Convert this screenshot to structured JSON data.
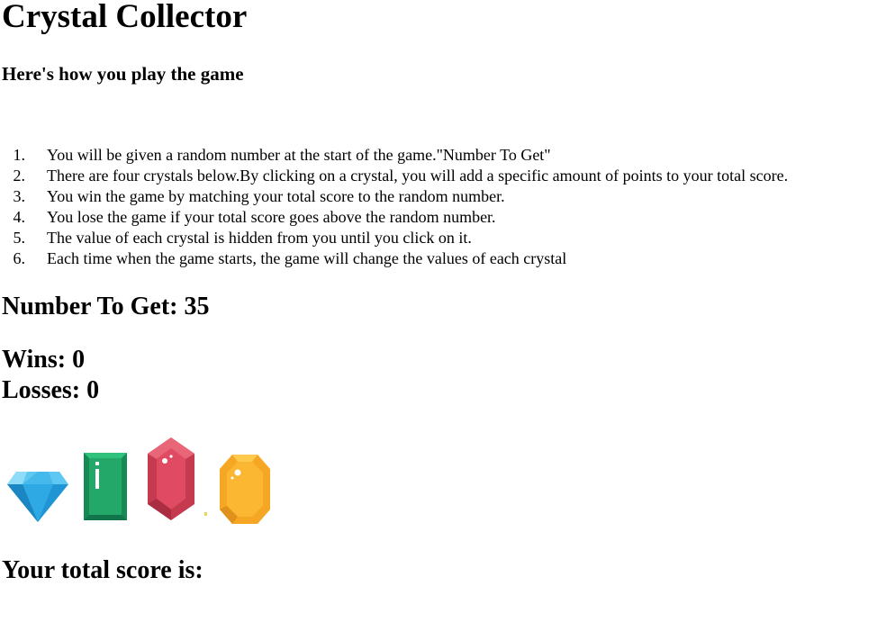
{
  "header": {
    "title": "Crystal Collector",
    "subtitle": "Here's how you play the game"
  },
  "rules": [
    {
      "num": "1.",
      "text": "You will be given a random number at the start of the game.\"Number To Get\""
    },
    {
      "num": "2.",
      "text": "There are four crystals below.By clicking on a crystal, you will add a specific amount of points to your total score."
    },
    {
      "num": "3.",
      "text": "You win the game by matching your total score to the random number."
    },
    {
      "num": "4.",
      "text": "You lose the game if your total score goes above the random number."
    },
    {
      "num": "5.",
      "text": "The value of each crystal is hidden from you until you click on it."
    },
    {
      "num": "6.",
      "text": "Each time when the game starts, the game will change the values of each crystal"
    }
  ],
  "status": {
    "target_label": "Number To Get: ",
    "target_value": "35",
    "wins_label": "Wins: ",
    "wins_value": "0",
    "losses_label": "Losses: ",
    "losses_value": "0",
    "score_label": "Your total score is:",
    "score_value": ""
  },
  "crystals": [
    {
      "icon": "blue-diamond-icon",
      "color": "#29a6e0"
    },
    {
      "icon": "green-emerald-icon",
      "color": "#23a86a"
    },
    {
      "icon": "red-ruby-icon",
      "color": "#e04b63"
    },
    {
      "icon": "yellow-topaz-icon",
      "color": "#fbb632"
    }
  ]
}
